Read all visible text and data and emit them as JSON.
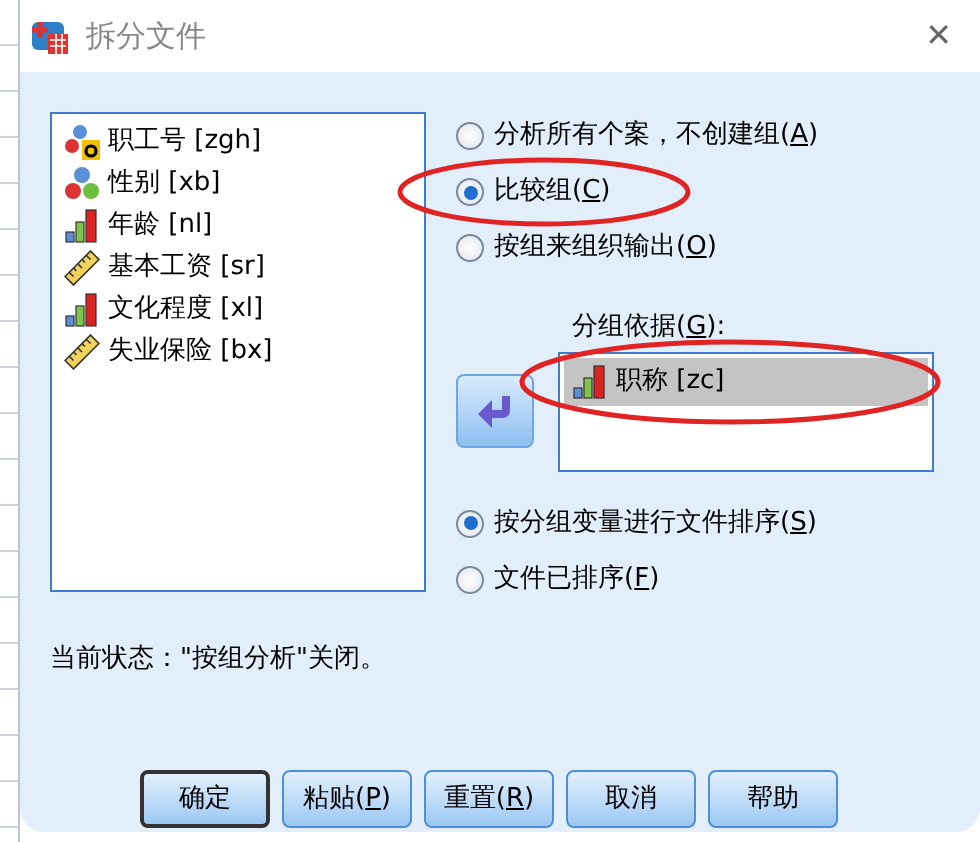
{
  "window": {
    "title": "拆分文件",
    "close": "✕"
  },
  "variables": [
    {
      "kind": "string-nominal",
      "label": "职工号 [zgh]"
    },
    {
      "kind": "nominal",
      "label": "性别 [xb]"
    },
    {
      "kind": "ordinal",
      "label": "年龄 [nl]"
    },
    {
      "kind": "scale",
      "label": "基本工资 [sr]"
    },
    {
      "kind": "ordinal",
      "label": "文化程度 [xl]"
    },
    {
      "kind": "scale",
      "label": "失业保险 [bx]"
    }
  ],
  "mode_options": [
    {
      "text": "分析所有个案，不创建组(",
      "access_key": "A",
      "text_end": ")",
      "selected": false,
      "circled": false
    },
    {
      "text": "比较组(",
      "access_key": "C",
      "text_end": ")",
      "selected": true,
      "circled": true
    },
    {
      "text": "按组来组织输出(",
      "access_key": "O",
      "text_end": ")",
      "selected": false,
      "circled": false
    }
  ],
  "groups_by": {
    "text": "分组依据(",
    "access_key": "G",
    "text_end": "):",
    "items": [
      {
        "kind": "ordinal",
        "label": "职称 [zc]",
        "selected": true,
        "circled": true
      }
    ]
  },
  "sort_options": [
    {
      "text": "按分组变量进行文件排序(",
      "access_key": "S",
      "text_end": ")",
      "selected": true
    },
    {
      "text": "文件已排序(",
      "access_key": "F",
      "text_end": ")",
      "selected": false
    }
  ],
  "status": "当前状态：\"按组分析\"关闭。",
  "buttons": [
    {
      "text": "确定",
      "default": true
    },
    {
      "text": "粘贴(",
      "access_key": "P",
      "text_end": ")",
      "default": false
    },
    {
      "text": "重置(",
      "access_key": "R",
      "text_end": ")",
      "default": false
    },
    {
      "text": "取消",
      "default": false
    },
    {
      "text": "帮助",
      "default": false
    }
  ]
}
